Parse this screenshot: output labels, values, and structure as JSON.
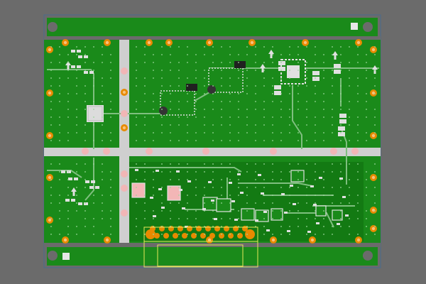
{
  "colors": {
    "background": "#6b6b6b",
    "outline": "#4a6b8c",
    "board": "#1a8a1a",
    "copper": "#0f6e0f",
    "pad": "#e0e0e0",
    "via_ring": "#e88a00",
    "via_hole": "#ff9a1a",
    "trace": "#7fbf7f",
    "silkscreen": "#f0f0f0",
    "connector": "#e8e85a",
    "highlight": "#f4b0b0",
    "component": "#202020"
  },
  "icons": {
    "mounting_hole": "mounting-hole-icon",
    "fiducial": "fiducial-icon",
    "arrow": "arrow-up-icon"
  }
}
